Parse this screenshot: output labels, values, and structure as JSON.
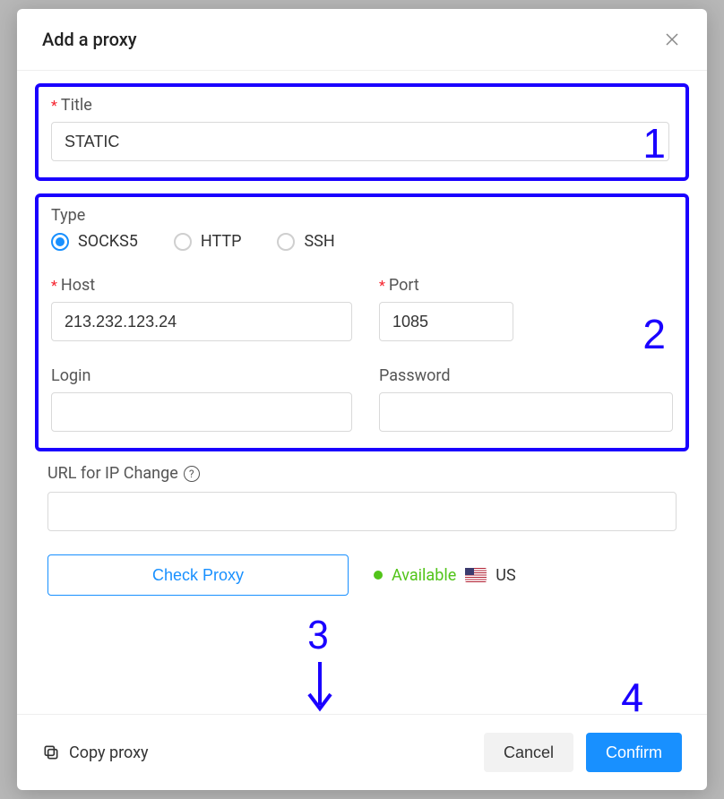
{
  "modal": {
    "title": "Add a proxy",
    "close_icon_name": "close-icon"
  },
  "section1": {
    "title_label": "Title",
    "title_value": "STATIC"
  },
  "section2": {
    "type_label": "Type",
    "radios": {
      "socks5": "SOCKS5",
      "http": "HTTP",
      "ssh": "SSH",
      "selected": "SOCKS5"
    },
    "host_label": "Host",
    "host_value": "213.232.123.24",
    "port_label": "Port",
    "port_value": "1085",
    "login_label": "Login",
    "login_value": "",
    "password_label": "Password",
    "password_value": ""
  },
  "url_section": {
    "label": "URL for IP Change",
    "value": ""
  },
  "check": {
    "button_label": "Check Proxy",
    "status_text": "Available",
    "country_code": "US"
  },
  "footer": {
    "copy_label": "Copy proxy",
    "cancel_label": "Cancel",
    "confirm_label": "Confirm"
  },
  "annotations": {
    "box1": "1",
    "box2": "2",
    "arrow3": "3",
    "arrow4": "4"
  }
}
